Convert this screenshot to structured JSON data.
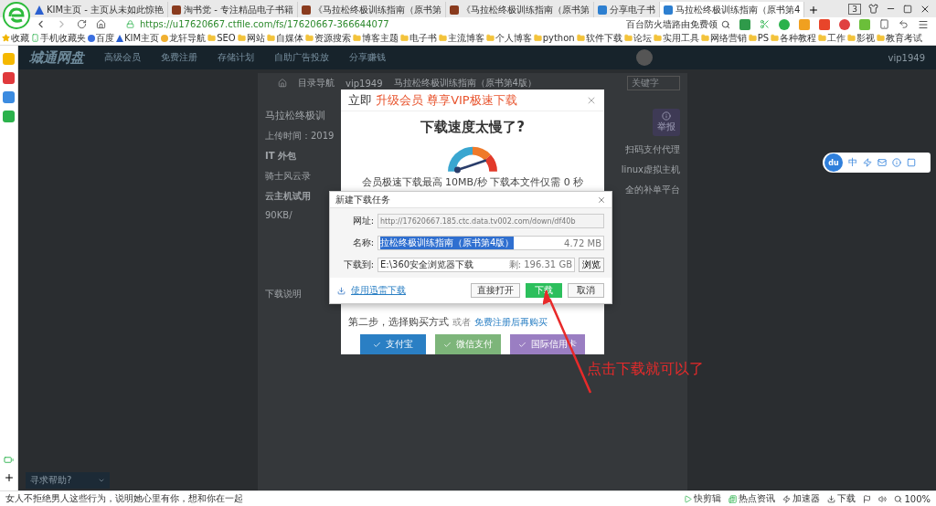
{
  "browser": {
    "tabs": [
      {
        "title": "KIM主页 - 主页从未如此惊艳",
        "kind": "kim",
        "selected": false
      },
      {
        "title": "淘书党 - 专注精品电子书籍",
        "kind": "book",
        "selected": false
      },
      {
        "title": "《马拉松终极训练指南（原书第",
        "kind": "book",
        "selected": false
      },
      {
        "title": "《马拉松终极训练指南（原书第",
        "kind": "book",
        "selected": false
      },
      {
        "title": "分享电子书",
        "kind": "ct",
        "selected": false
      },
      {
        "title": "马拉松终极训练指南（原书第4",
        "kind": "ct",
        "selected": true
      }
    ],
    "tab_count": "3",
    "url": "https://u17620667.ctfile.com/fs/17620667-366644077",
    "search": "百台防火墙路由免费领",
    "bookmarks": [
      {
        "label": "收藏",
        "kind": "star"
      },
      {
        "label": "手机收藏夹",
        "kind": "phone"
      },
      {
        "label": "百度",
        "kind": "paw"
      },
      {
        "label": "KIM主页",
        "kind": "kim"
      },
      {
        "label": "龙轩导航",
        "kind": "gourd"
      },
      {
        "label": "SEO",
        "kind": "folder"
      },
      {
        "label": "网站",
        "kind": "folder"
      },
      {
        "label": "自媒体",
        "kind": "folder"
      },
      {
        "label": "资源搜索",
        "kind": "folder"
      },
      {
        "label": "博客主题",
        "kind": "folder"
      },
      {
        "label": "电子书",
        "kind": "folder"
      },
      {
        "label": "主流博客",
        "kind": "folder"
      },
      {
        "label": "个人博客",
        "kind": "folder"
      },
      {
        "label": "python",
        "kind": "folder"
      },
      {
        "label": "软件下载",
        "kind": "folder"
      },
      {
        "label": "论坛",
        "kind": "folder"
      },
      {
        "label": "实用工具",
        "kind": "folder"
      },
      {
        "label": "网络营销",
        "kind": "folder"
      },
      {
        "label": "PS",
        "kind": "folder"
      },
      {
        "label": "各种教程",
        "kind": "folder"
      },
      {
        "label": "工作",
        "kind": "folder"
      },
      {
        "label": "影视",
        "kind": "folder"
      },
      {
        "label": "教育考试",
        "kind": "folder"
      }
    ]
  },
  "site": {
    "logo": "城通网盘",
    "nav": [
      "高级会员",
      "免费注册",
      "存储计划",
      "自助广告投放",
      "分享赚钱"
    ],
    "user": "vip1949",
    "breadcrumb": [
      "目录导航",
      "vip1949",
      "马拉松终极训练指南（原书第4版）"
    ],
    "search_placeholder": "关键字",
    "file_title": "马拉松终极训",
    "upload_time": "上传时间：2019",
    "left_links": [
      "IT 外包",
      "骑士风云录",
      "云主机试用"
    ],
    "speed": "90KB/",
    "download_note": "下载说明",
    "report": "举报",
    "right_links": [
      "扫码支付代理",
      "linux虚拟主机",
      "全的补单平台"
    ]
  },
  "vip_modal": {
    "title_prefix": "立即",
    "title_highlight": "升级会员 尊享VIP极速下载",
    "heading": "下载速度太慢了?",
    "speed_text": "会员极速下载最高 10MB/秒 下载本文件仅需 0 秒",
    "step": "第二步，选择购买方式",
    "or": "或者",
    "register_link": "免费注册后再购买",
    "pay": [
      {
        "label": "支付宝",
        "color": "#2a7fc4"
      },
      {
        "label": "微信支付",
        "color": "#7db57a"
      },
      {
        "label": "国际信用卡",
        "color": "#9a7ec2"
      }
    ]
  },
  "download_dialog": {
    "title": "新建下载任务",
    "fields": [
      {
        "label": "网址:",
        "kind": "url",
        "value": "http://17620667.185.ctc.data.tv002.com/down/df40b"
      },
      {
        "label": "名称:",
        "kind": "name",
        "value": "拉松终极训练指南（原书第4版）",
        "size": "4.72 MB"
      },
      {
        "label": "下载到:",
        "kind": "path",
        "value": "E:\\360安全浏览器下载",
        "free": "剩: 196.31 GB",
        "button": "浏览"
      }
    ],
    "thunder_link": "使用迅雷下载",
    "buttons": [
      {
        "label": "直接打开",
        "primary": false
      },
      {
        "label": "下载",
        "primary": true
      },
      {
        "label": "取消",
        "primary": false
      }
    ]
  },
  "annotation": "点击下载就可以了",
  "floating_toolbar": {
    "logo": "du",
    "lang": "中"
  },
  "chat_tab": "寻求帮助?",
  "status_bar": {
    "news": "女人不拒绝男人这些行为，说明她心里有你，想和你在一起",
    "items": [
      "快剪辑",
      "热点资讯",
      "加速器",
      "下载"
    ],
    "zoom": "100%"
  }
}
